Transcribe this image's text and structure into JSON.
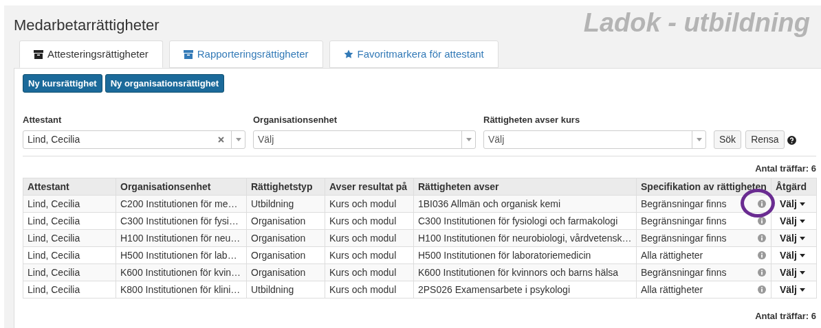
{
  "page_title": "Medarbetarrättigheter",
  "brand": "Ladok - utbildning",
  "tabs": [
    {
      "label": "Attesteringsrättigheter",
      "kind": "archive",
      "selected": true
    },
    {
      "label": "Rapporteringsrättigheter",
      "kind": "archive",
      "selected": false
    },
    {
      "label": "Favoritmarkera för attestant",
      "kind": "star",
      "selected": false
    }
  ],
  "actions": [
    "Ny kursrättighet",
    "Ny organisationsrättighet"
  ],
  "filters": [
    {
      "label": "Attestant",
      "value": "Lind, Cecilia",
      "clearable": true
    },
    {
      "label": "Organisationsenhet",
      "placeholder": "Välj",
      "clearable": false
    },
    {
      "label": "Rättigheten avser kurs",
      "placeholder": "Välj",
      "clearable": false
    }
  ],
  "search_button": "Sök",
  "clear_button": "Rensa",
  "hit_count_top": "Antal träffar: 6",
  "table": {
    "columns": [
      "Attestant",
      "Organisationsenhet",
      "Rättighetstyp",
      "Avser resultat på",
      "Rättigheten avser",
      "Specifikation av rättigheten",
      "Åtgärd"
    ],
    "rows": [
      {
        "cells": [
          "Lind, Cecilia",
          "C200 Institutionen för me…",
          "Utbildning",
          "Kurs och modul",
          "1BI036 Allmän och organisk kemi",
          "Begränsningar finns"
        ],
        "action": "Välj",
        "circled": true
      },
      {
        "cells": [
          "Lind, Cecilia",
          "C300 Institutionen för fysi…",
          "Organisation",
          "Kurs och modul",
          "C300 Institutionen för fysiologi och farmakologi",
          "Begränsningar finns"
        ],
        "action": "Välj",
        "circled": false
      },
      {
        "cells": [
          "Lind, Cecilia",
          "H100 Institutionen för neu…",
          "Organisation",
          "Kurs och modul",
          "H100 Institutionen för neurobiologi, vårdvetensk…",
          "Begränsningar finns"
        ],
        "action": "Välj",
        "circled": false
      },
      {
        "cells": [
          "Lind, Cecilia",
          "H500 Institutionen för lab…",
          "Organisation",
          "Kurs och modul",
          "H500 Institutionen för laboratoriemedicin",
          "Alla rättigheter"
        ],
        "action": "Välj",
        "circled": false
      },
      {
        "cells": [
          "Lind, Cecilia",
          "K600 Institutionen för kvin…",
          "Organisation",
          "Kurs och modul",
          "K600 Institutionen för kvinnors och barns hälsa",
          "Begränsningar finns"
        ],
        "action": "Välj",
        "circled": false
      },
      {
        "cells": [
          "Lind, Cecilia",
          "K800 Institutionen för klini…",
          "Utbildning",
          "Kurs och modul",
          "2PS026 Examensarbete i psykologi",
          "Alla rättigheter"
        ],
        "action": "Välj",
        "circled": false
      }
    ]
  },
  "hit_count_bottom": "Antal träffar: 6"
}
